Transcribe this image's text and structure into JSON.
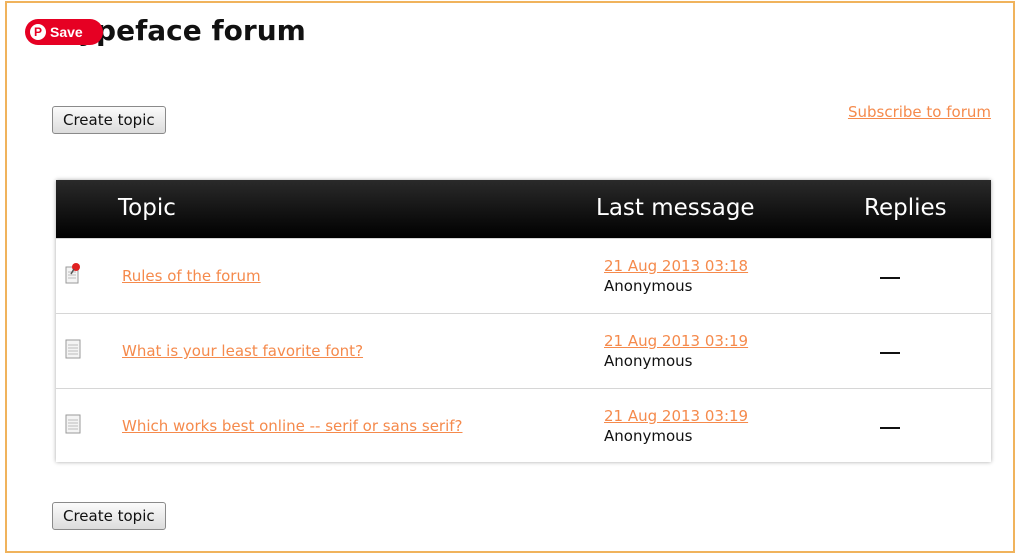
{
  "page": {
    "title": "Typeface forum"
  },
  "pinterest": {
    "save_label": "Save",
    "logo": "P"
  },
  "actions": {
    "create_topic_label": "Create topic",
    "subscribe_label": "Subscribe to forum"
  },
  "table": {
    "headers": {
      "topic": "Topic",
      "last_message": "Last message",
      "replies": "Replies"
    },
    "rows": [
      {
        "icon": "pinned-document-icon",
        "title": "Rules of the forum",
        "last_date": "21 Aug 2013 03:18",
        "last_author": "Anonymous",
        "replies": "—"
      },
      {
        "icon": "document-icon",
        "title": "What is your least favorite font?",
        "last_date": "21 Aug 2013 03:19",
        "last_author": "Anonymous",
        "replies": "—"
      },
      {
        "icon": "document-icon",
        "title": "Which works best online -- serif or sans serif?",
        "last_date": "21 Aug 2013 03:19",
        "last_author": "Anonymous",
        "replies": "—"
      }
    ]
  },
  "colors": {
    "accent": "#f58a4c",
    "frame": "#f0b35c",
    "pinterest_red": "#e60023",
    "header_bg": "#000000"
  }
}
